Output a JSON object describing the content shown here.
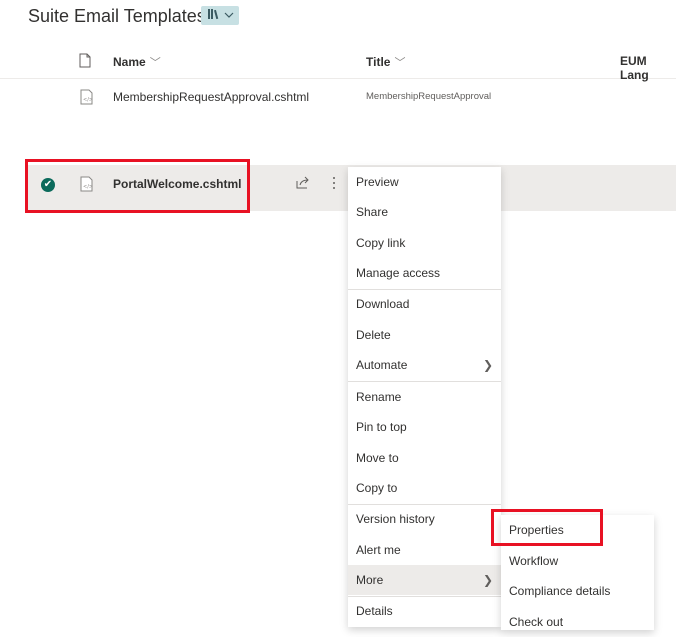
{
  "library": {
    "title": "Suite Email Templates",
    "view_icon": "library-icon"
  },
  "columns": {
    "name": "Name",
    "title": "Title",
    "eum": "EUM Lang"
  },
  "rows": [
    {
      "name": "MembershipRequestApproval.cshtml",
      "title": "MembershipRequestApproval"
    },
    {
      "name": "PortalWelcome.cshtml",
      "title": "",
      "selected": true
    }
  ],
  "context_menu": {
    "items": [
      "Preview",
      "Share",
      "Copy link",
      "Manage access",
      "Download",
      "Delete",
      "Automate",
      "Rename",
      "Pin to top",
      "Move to",
      "Copy to",
      "Version history",
      "Alert me",
      "More",
      "Details"
    ]
  },
  "submenu": {
    "items": [
      "Properties",
      "Workflow",
      "Compliance details",
      "Check out"
    ]
  },
  "colors": {
    "accent": "#0b6a5b",
    "highlight_box": "#e81123",
    "selection": "#edebe9"
  }
}
